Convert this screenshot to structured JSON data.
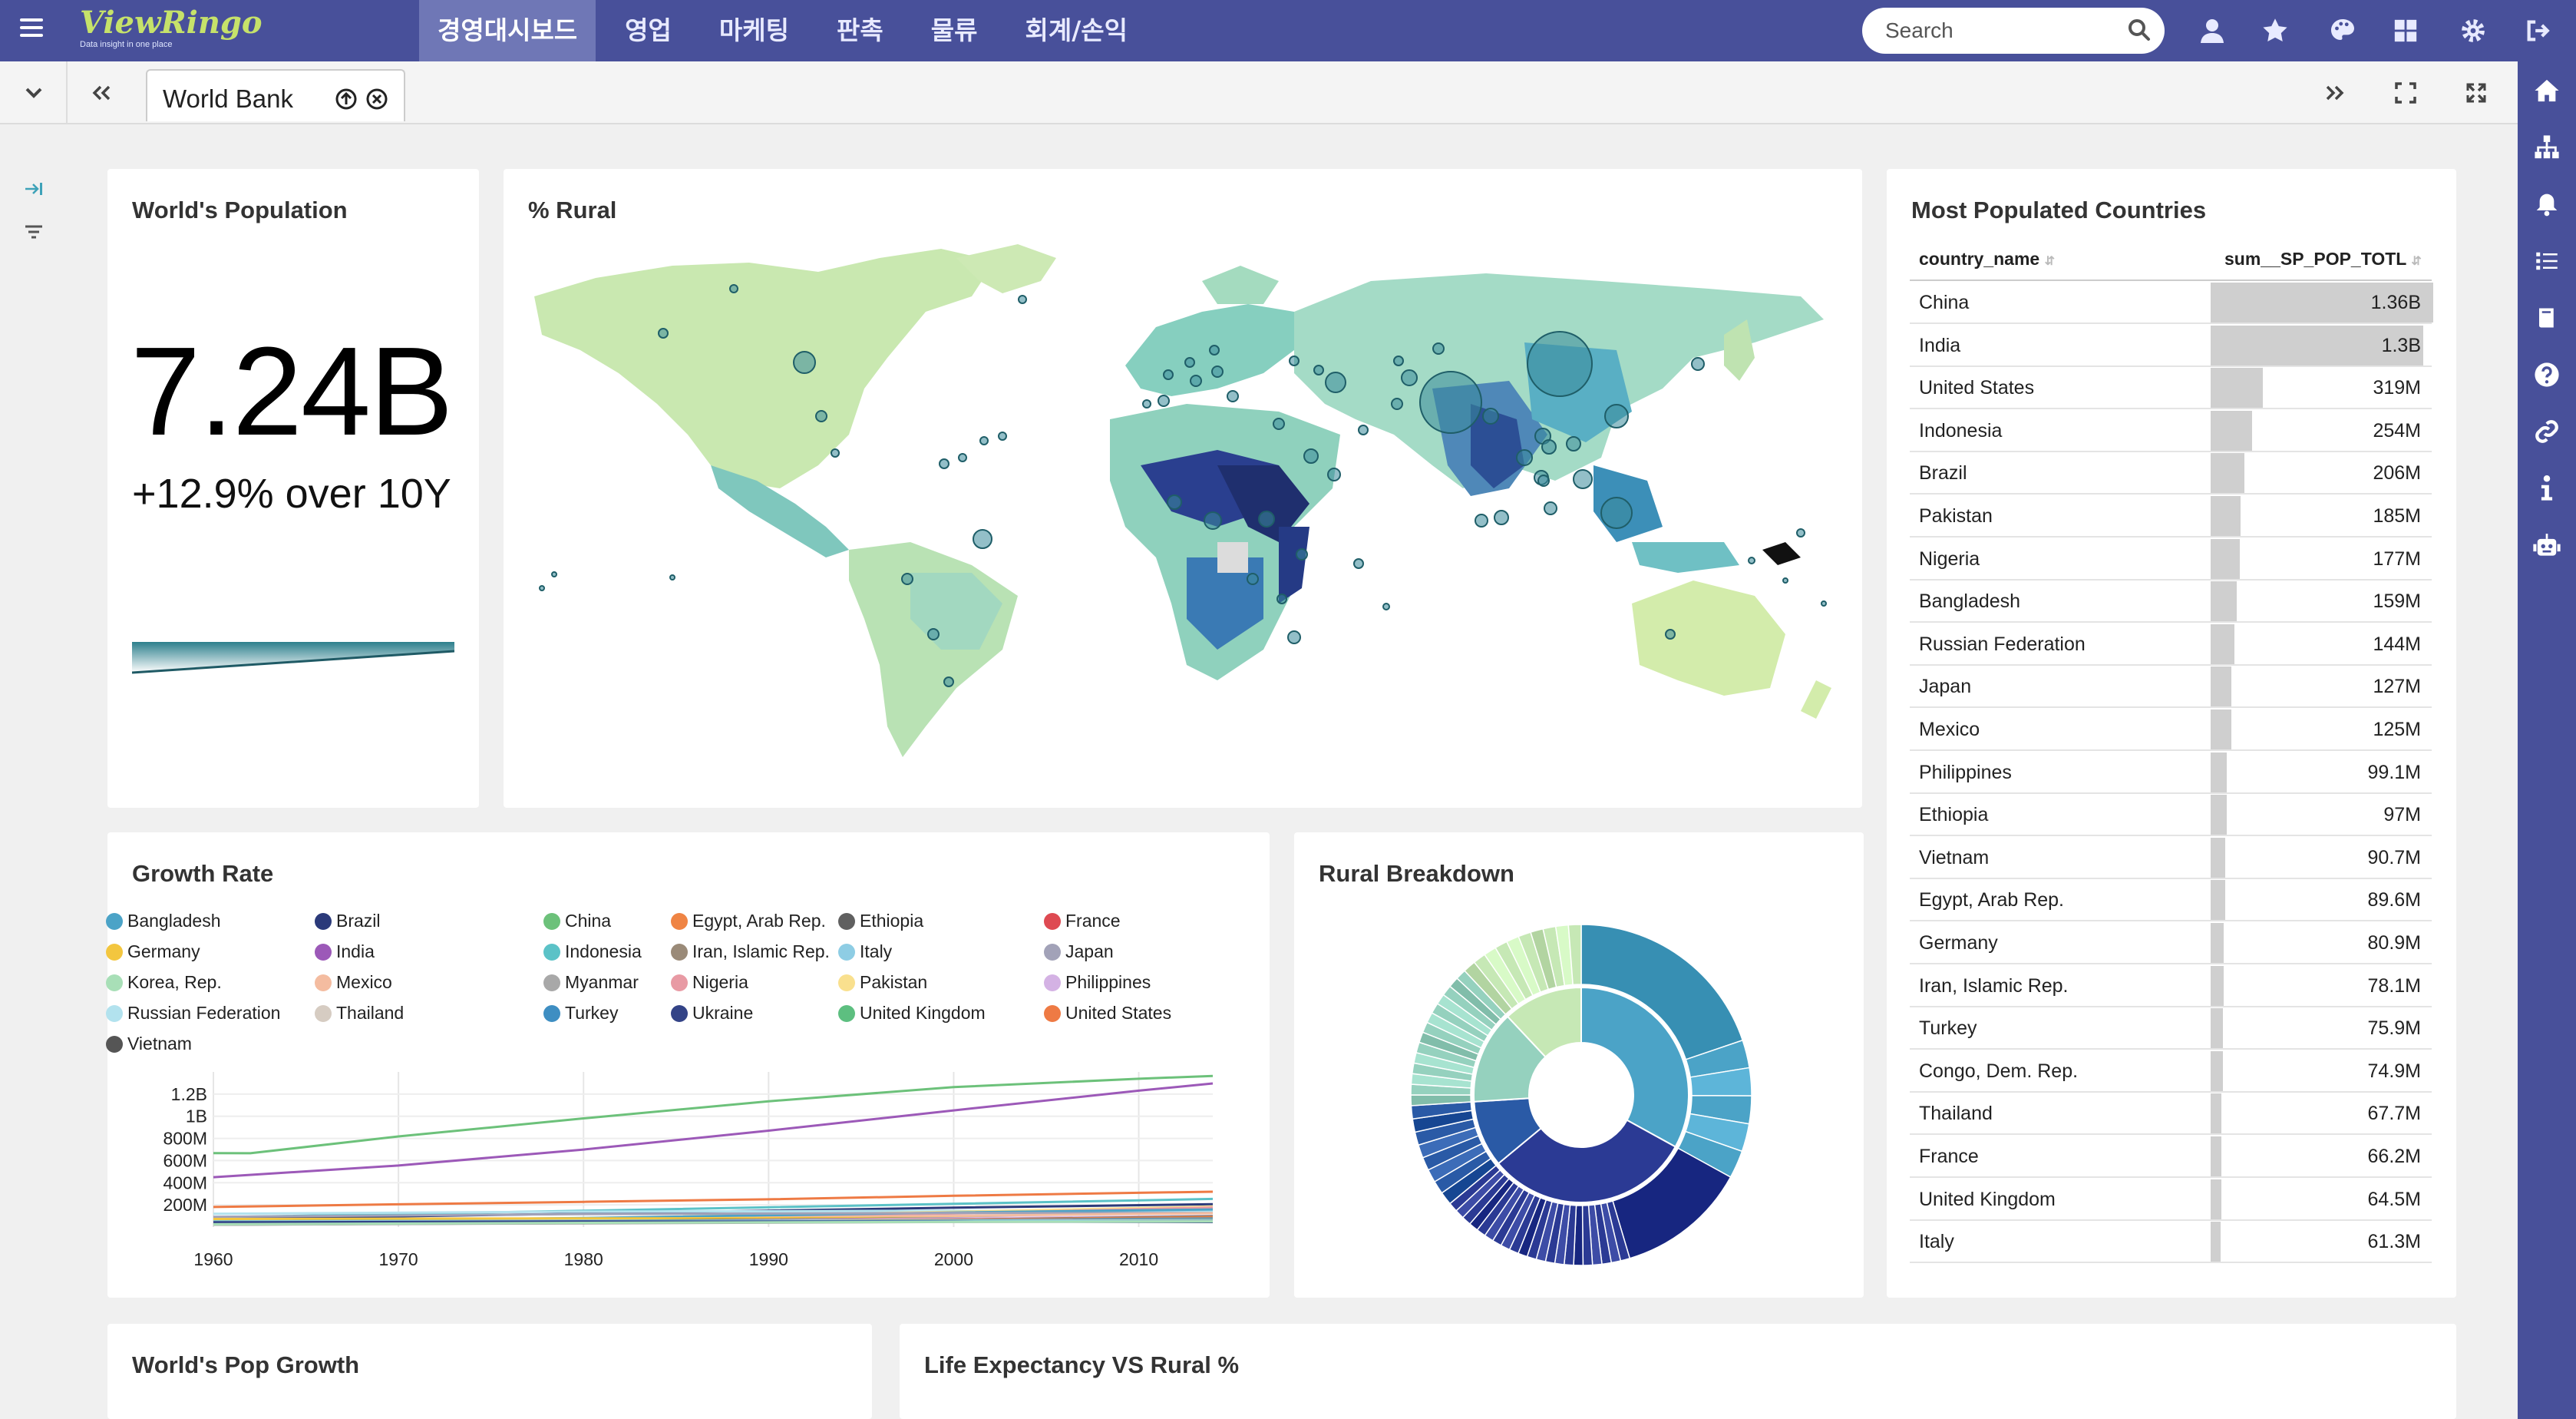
{
  "app": {
    "logo_text": "ViewRingo",
    "logo_sub": "Data insight in one place"
  },
  "nav": [
    "경영대시보드",
    "영업",
    "마케팅",
    "판촉",
    "물류",
    "회계/손익"
  ],
  "search": {
    "placeholder": "Search"
  },
  "tab": {
    "label": "World Bank"
  },
  "population": {
    "title": "World's Population",
    "value": "7.24B",
    "change": "+12.9% over 10Y"
  },
  "rural_map": {
    "title": "% Rural"
  },
  "growth": {
    "title": "Growth Rate",
    "legend": [
      {
        "name": "Bangladesh",
        "color": "#4ba3c7"
      },
      {
        "name": "Brazil",
        "color": "#2b3a7a"
      },
      {
        "name": "China",
        "color": "#6cc17a"
      },
      {
        "name": "Egypt, Arab Rep.",
        "color": "#ef8444"
      },
      {
        "name": "Ethiopia",
        "color": "#606060"
      },
      {
        "name": "France",
        "color": "#de4a52"
      },
      {
        "name": "Germany",
        "color": "#f3c63f"
      },
      {
        "name": "India",
        "color": "#9c59b8"
      },
      {
        "name": "Indonesia",
        "color": "#5bc2c7"
      },
      {
        "name": "Iran, Islamic Rep.",
        "color": "#9a8a78"
      },
      {
        "name": "Italy",
        "color": "#8ecde4"
      },
      {
        "name": "Japan",
        "color": "#a2a2b8"
      },
      {
        "name": "Korea, Rep.",
        "color": "#a8dfb7"
      },
      {
        "name": "Mexico",
        "color": "#f4bca0"
      },
      {
        "name": "Myanmar",
        "color": "#a8a8a8"
      },
      {
        "name": "Nigeria",
        "color": "#e89aa4"
      },
      {
        "name": "Pakistan",
        "color": "#f9e08e"
      },
      {
        "name": "Philippines",
        "color": "#d4b2e4"
      },
      {
        "name": "Russian Federation",
        "color": "#b2e2ee"
      },
      {
        "name": "Thailand",
        "color": "#d6ccc2"
      },
      {
        "name": "Turkey",
        "color": "#3e8ec2"
      },
      {
        "name": "Ukraine",
        "color": "#334387"
      },
      {
        "name": "United Kingdom",
        "color": "#5dbf80"
      },
      {
        "name": "United States",
        "color": "#ee7a44"
      },
      {
        "name": "Vietnam",
        "color": "#555555"
      }
    ]
  },
  "rural_breakdown": {
    "title": "Rural Breakdown"
  },
  "most_populated": {
    "title": "Most Populated Countries",
    "col1": "country_name",
    "col2": "sum__SP_POP_TOTL"
  },
  "pop_growth": {
    "title": "World's Pop Growth"
  },
  "life_expectancy": {
    "title": "Life Expectancy VS Rural %"
  },
  "chart_data": [
    {
      "type": "table",
      "title": "Most Populated Countries",
      "columns": [
        "country_name",
        "sum__SP_POP_TOTL"
      ],
      "rows": [
        [
          "China",
          "1.36B"
        ],
        [
          "India",
          "1.3B"
        ],
        [
          "United States",
          "319M"
        ],
        [
          "Indonesia",
          "254M"
        ],
        [
          "Brazil",
          "206M"
        ],
        [
          "Pakistan",
          "185M"
        ],
        [
          "Nigeria",
          "177M"
        ],
        [
          "Bangladesh",
          "159M"
        ],
        [
          "Russian Federation",
          "144M"
        ],
        [
          "Japan",
          "127M"
        ],
        [
          "Mexico",
          "125M"
        ],
        [
          "Philippines",
          "99.1M"
        ],
        [
          "Ethiopia",
          "97M"
        ],
        [
          "Vietnam",
          "90.7M"
        ],
        [
          "Egypt, Arab Rep.",
          "89.6M"
        ],
        [
          "Germany",
          "80.9M"
        ],
        [
          "Iran, Islamic Rep.",
          "78.1M"
        ],
        [
          "Turkey",
          "75.9M"
        ],
        [
          "Congo, Dem. Rep.",
          "74.9M"
        ],
        [
          "Thailand",
          "67.7M"
        ],
        [
          "France",
          "66.2M"
        ],
        [
          "United Kingdom",
          "64.5M"
        ],
        [
          "Italy",
          "61.3M"
        ]
      ],
      "values_millions": [
        1360,
        1300,
        319,
        254,
        206,
        185,
        177,
        159,
        144,
        127,
        125,
        99.1,
        97,
        90.7,
        89.6,
        80.9,
        78.1,
        75.9,
        74.9,
        67.7,
        66.2,
        64.5,
        61.3
      ]
    },
    {
      "type": "line",
      "title": "Growth Rate",
      "x_ticks": [
        "1960",
        "1970",
        "1980",
        "1990",
        "2000",
        "2010"
      ],
      "y_ticks": [
        "200M",
        "400M",
        "600M",
        "800M",
        "1B",
        "1.2B"
      ],
      "xlim": [
        1960,
        2014
      ],
      "ylim": [
        0,
        1400
      ],
      "series": [
        {
          "name": "China",
          "color": "#6cc17a",
          "x": [
            1960,
            1962,
            1970,
            1980,
            1990,
            2000,
            2010,
            2014
          ],
          "y": [
            667,
            666,
            818,
            981,
            1135,
            1263,
            1338,
            1364
          ]
        },
        {
          "name": "India",
          "color": "#9c59b8",
          "x": [
            1960,
            1970,
            1980,
            1990,
            2000,
            2010,
            2014
          ],
          "y": [
            450,
            555,
            699,
            870,
            1053,
            1231,
            1296
          ]
        },
        {
          "name": "United States",
          "color": "#ee7a44",
          "x": [
            1960,
            1970,
            1980,
            1990,
            2000,
            2010,
            2014
          ],
          "y": [
            181,
            205,
            227,
            250,
            282,
            309,
            319
          ]
        },
        {
          "name": "Indonesia",
          "color": "#5bc2c7",
          "x": [
            1960,
            1980,
            2000,
            2014
          ],
          "y": [
            88,
            147,
            209,
            254
          ]
        },
        {
          "name": "Brazil",
          "color": "#2b3a7a",
          "x": [
            1960,
            1980,
            2000,
            2014
          ],
          "y": [
            72,
            121,
            175,
            206
          ]
        },
        {
          "name": "Russian Federation",
          "color": "#b2e2ee",
          "x": [
            1960,
            1980,
            2000,
            2014
          ],
          "y": [
            120,
            139,
            147,
            144
          ]
        },
        {
          "name": "Pakistan",
          "color": "#f9e08e",
          "x": [
            1960,
            1980,
            2000,
            2014
          ],
          "y": [
            45,
            80,
            138,
            185
          ]
        },
        {
          "name": "Nigeria",
          "color": "#e89aa4",
          "x": [
            1960,
            1980,
            2000,
            2014
          ],
          "y": [
            45,
            74,
            122,
            177
          ]
        },
        {
          "name": "Bangladesh",
          "color": "#4ba3c7",
          "x": [
            1960,
            1980,
            2000,
            2014
          ],
          "y": [
            48,
            81,
            131,
            159
          ]
        },
        {
          "name": "Japan",
          "color": "#a2a2b8",
          "x": [
            1960,
            1980,
            2000,
            2014
          ],
          "y": [
            92,
            117,
            127,
            127
          ]
        },
        {
          "name": "Mexico",
          "color": "#f4bca0",
          "x": [
            1960,
            1980,
            2000,
            2014
          ],
          "y": [
            38,
            68,
            101,
            125
          ]
        },
        {
          "name": "Germany",
          "color": "#f3c63f",
          "x": [
            1960,
            1980,
            2000,
            2014
          ],
          "y": [
            73,
            78,
            82,
            81
          ]
        },
        {
          "name": "Vietnam",
          "color": "#555555",
          "x": [
            1960,
            1980,
            2000,
            2014
          ],
          "y": [
            32,
            54,
            80,
            91
          ]
        },
        {
          "name": "Philippines",
          "color": "#d4b2e4",
          "x": [
            1960,
            1980,
            2000,
            2014
          ],
          "y": [
            26,
            47,
            78,
            99
          ]
        },
        {
          "name": "Ethiopia",
          "color": "#606060",
          "x": [
            1960,
            1980,
            2000,
            2014
          ],
          "y": [
            22,
            35,
            66,
            97
          ]
        },
        {
          "name": "Egypt, Arab Rep.",
          "color": "#ef8444",
          "x": [
            1960,
            1980,
            2000,
            2014
          ],
          "y": [
            27,
            44,
            68,
            90
          ]
        },
        {
          "name": "Iran, Islamic Rep.",
          "color": "#9a8a78",
          "x": [
            1960,
            1980,
            2000,
            2014
          ],
          "y": [
            21,
            38,
            65,
            78
          ]
        },
        {
          "name": "Turkey",
          "color": "#3e8ec2",
          "x": [
            1960,
            1980,
            2000,
            2014
          ],
          "y": [
            27,
            44,
            63,
            76
          ]
        },
        {
          "name": "Thailand",
          "color": "#d6ccc2",
          "x": [
            1960,
            1980,
            2000,
            2014
          ],
          "y": [
            27,
            47,
            62,
            68
          ]
        },
        {
          "name": "France",
          "color": "#de4a52",
          "x": [
            1960,
            1980,
            2000,
            2014
          ],
          "y": [
            46,
            54,
            60,
            66
          ]
        },
        {
          "name": "United Kingdom",
          "color": "#5dbf80",
          "x": [
            1960,
            1980,
            2000,
            2014
          ],
          "y": [
            52,
            56,
            58,
            64
          ]
        },
        {
          "name": "Italy",
          "color": "#8ecde4",
          "x": [
            1960,
            1980,
            2000,
            2014
          ],
          "y": [
            50,
            56,
            57,
            61
          ]
        },
        {
          "name": "Ukraine",
          "color": "#334387",
          "x": [
            1960,
            1980,
            2000,
            2014
          ],
          "y": [
            43,
            50,
            49,
            45
          ]
        },
        {
          "name": "Myanmar",
          "color": "#a8a8a8",
          "x": [
            1960,
            1980,
            2000,
            2014
          ],
          "y": [
            21,
            33,
            46,
            53
          ]
        },
        {
          "name": "Korea, Rep.",
          "color": "#a8dfb7",
          "x": [
            1960,
            1980,
            2000,
            2014
          ],
          "y": [
            25,
            38,
            47,
            50
          ]
        }
      ]
    },
    {
      "type": "pie",
      "title": "Rural Breakdown",
      "inner_rings": [
        {
          "color": "#4ba3c7",
          "value": 33
        },
        {
          "color": "#2b3a94",
          "value": 31
        },
        {
          "color": "#2a5aa6",
          "value": 10
        },
        {
          "color": "#95d1be",
          "value": 14
        },
        {
          "color": "#c6e8b5",
          "value": 12
        }
      ]
    }
  ]
}
